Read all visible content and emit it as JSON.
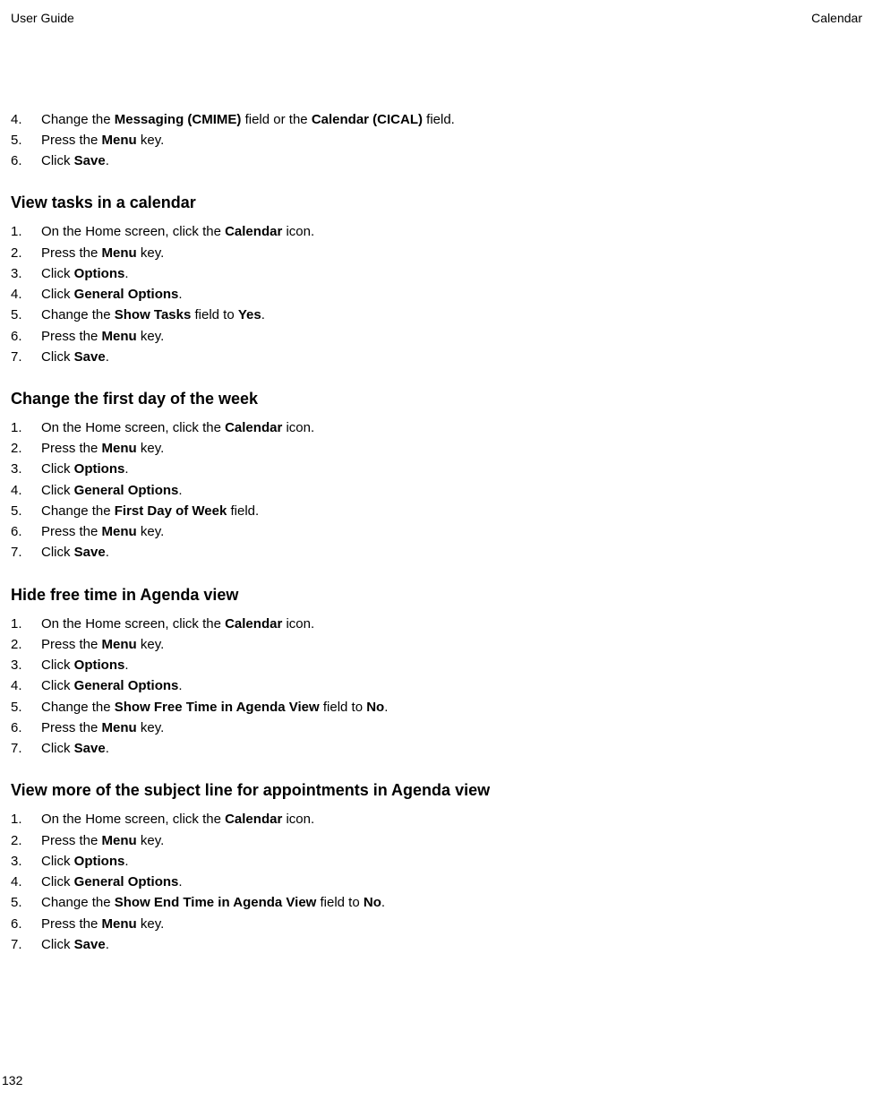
{
  "header": {
    "left": "User Guide",
    "right": "Calendar"
  },
  "intro_list": {
    "items": [
      {
        "num": "4.",
        "parts": [
          "Change the ",
          "Messaging (CMIME)",
          " field or the ",
          "Calendar (CICAL)",
          " field."
        ]
      },
      {
        "num": "5.",
        "parts": [
          "Press the ",
          "Menu",
          " key."
        ]
      },
      {
        "num": "6.",
        "parts": [
          "Click ",
          "Save",
          "."
        ]
      }
    ]
  },
  "sections": [
    {
      "heading": "View tasks in a calendar",
      "items": [
        {
          "num": "1.",
          "parts": [
            "On the Home screen, click the ",
            "Calendar",
            " icon."
          ]
        },
        {
          "num": "2.",
          "parts": [
            "Press the ",
            "Menu",
            " key."
          ]
        },
        {
          "num": "3.",
          "parts": [
            "Click ",
            "Options",
            "."
          ]
        },
        {
          "num": "4.",
          "parts": [
            "Click ",
            "General Options",
            "."
          ]
        },
        {
          "num": "5.",
          "parts": [
            "Change the ",
            "Show Tasks",
            " field to ",
            "Yes",
            "."
          ]
        },
        {
          "num": "6.",
          "parts": [
            "Press the ",
            "Menu",
            " key."
          ]
        },
        {
          "num": "7.",
          "parts": [
            "Click ",
            "Save",
            "."
          ]
        }
      ]
    },
    {
      "heading": "Change the first day of the week",
      "items": [
        {
          "num": "1.",
          "parts": [
            "On the Home screen, click the ",
            "Calendar",
            " icon."
          ]
        },
        {
          "num": "2.",
          "parts": [
            "Press the ",
            "Menu",
            " key."
          ]
        },
        {
          "num": "3.",
          "parts": [
            "Click ",
            "Options",
            "."
          ]
        },
        {
          "num": "4.",
          "parts": [
            "Click ",
            "General Options",
            "."
          ]
        },
        {
          "num": "5.",
          "parts": [
            "Change the ",
            "First Day of Week",
            " field."
          ]
        },
        {
          "num": "6.",
          "parts": [
            "Press the ",
            "Menu",
            " key."
          ]
        },
        {
          "num": "7.",
          "parts": [
            "Click ",
            "Save",
            "."
          ]
        }
      ]
    },
    {
      "heading": "Hide free time in Agenda view",
      "items": [
        {
          "num": "1.",
          "parts": [
            "On the Home screen, click the ",
            "Calendar",
            " icon."
          ]
        },
        {
          "num": "2.",
          "parts": [
            "Press the ",
            "Menu",
            " key."
          ]
        },
        {
          "num": "3.",
          "parts": [
            "Click ",
            "Options",
            "."
          ]
        },
        {
          "num": "4.",
          "parts": [
            "Click ",
            "General Options",
            "."
          ]
        },
        {
          "num": "5.",
          "parts": [
            "Change the ",
            "Show Free Time in Agenda View",
            " field to ",
            "No",
            "."
          ]
        },
        {
          "num": "6.",
          "parts": [
            "Press the ",
            "Menu",
            " key."
          ]
        },
        {
          "num": "7.",
          "parts": [
            "Click ",
            "Save",
            "."
          ]
        }
      ]
    },
    {
      "heading": "View more of the subject line for appointments in Agenda view",
      "items": [
        {
          "num": "1.",
          "parts": [
            "On the Home screen, click the ",
            "Calendar",
            " icon."
          ]
        },
        {
          "num": "2.",
          "parts": [
            "Press the ",
            "Menu",
            " key."
          ]
        },
        {
          "num": "3.",
          "parts": [
            "Click ",
            "Options",
            "."
          ]
        },
        {
          "num": "4.",
          "parts": [
            "Click ",
            "General Options",
            "."
          ]
        },
        {
          "num": "5.",
          "parts": [
            "Change the ",
            "Show End Time in Agenda View",
            " field to ",
            "No",
            "."
          ]
        },
        {
          "num": "6.",
          "parts": [
            "Press the ",
            "Menu",
            " key."
          ]
        },
        {
          "num": "7.",
          "parts": [
            "Click ",
            "Save",
            "."
          ]
        }
      ]
    }
  ],
  "page_number": "132"
}
